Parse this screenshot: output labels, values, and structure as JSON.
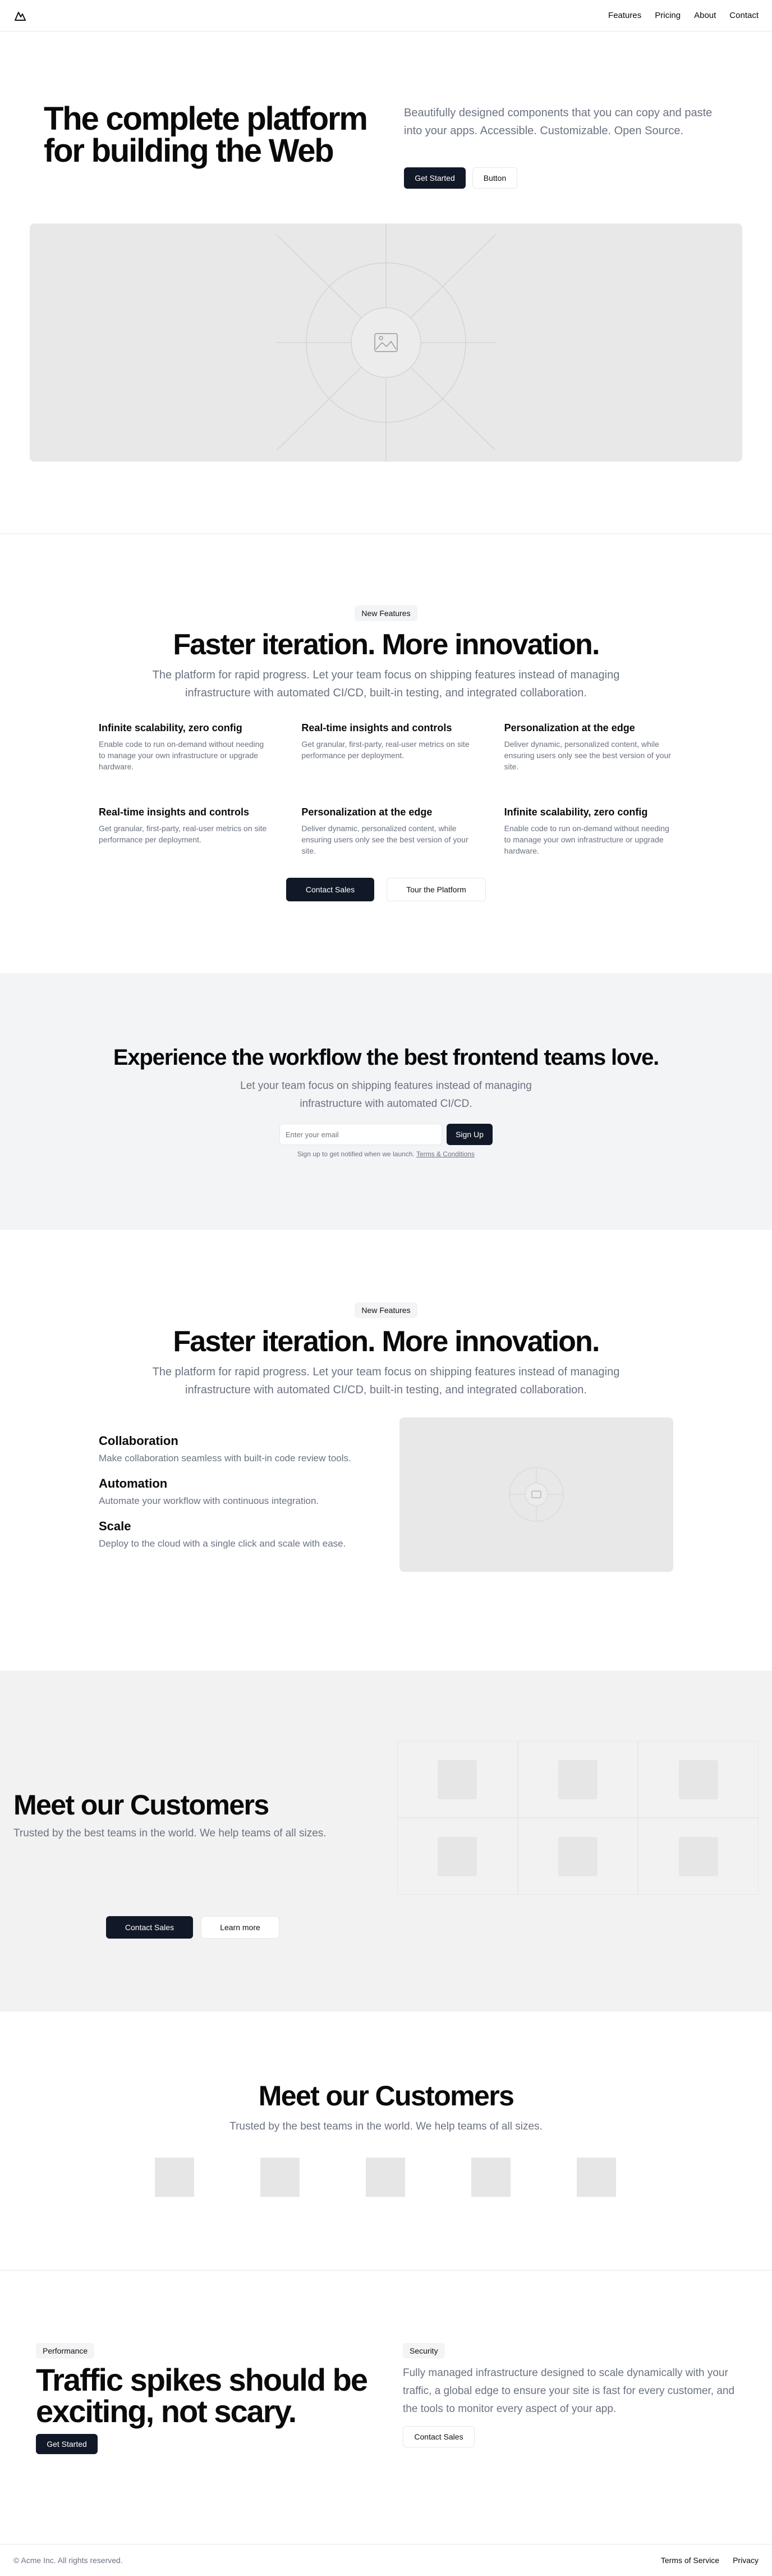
{
  "header": {
    "nav": [
      "Features",
      "Pricing",
      "About",
      "Contact"
    ]
  },
  "hero": {
    "title": "The complete platform for building the Web",
    "description": "Beautifully designed components that you can copy and paste into your apps. Accessible. Customizable. Open Source.",
    "primary_button": "Get Started",
    "secondary_button": "Button"
  },
  "features": {
    "badge": "New Features",
    "title": "Faster iteration. More innovation.",
    "subtitle": "The platform for rapid progress. Let your team focus on shipping features instead of managing infrastructure with automated CI/CD, built-in testing, and integrated collaboration.",
    "items": [
      {
        "title": "Infinite scalability, zero config",
        "text": "Enable code to run on-demand without needing to manage your own infrastructure or upgrade hardware."
      },
      {
        "title": "Real-time insights and controls",
        "text": "Get granular, first-party, real-user metrics on site performance per deployment."
      },
      {
        "title": "Personalization at the edge",
        "text": "Deliver dynamic, personalized content, while ensuring users only see the best version of your site."
      },
      {
        "title": "Real-time insights and controls",
        "text": "Get granular, first-party, real-user metrics on site performance per deployment."
      },
      {
        "title": "Personalization at the edge",
        "text": "Deliver dynamic, personalized content, while ensuring users only see the best version of your site."
      },
      {
        "title": "Infinite scalability, zero config",
        "text": "Enable code to run on-demand without needing to manage your own infrastructure or upgrade hardware."
      }
    ],
    "primary_button": "Contact Sales",
    "secondary_button": "Tour the Platform"
  },
  "signup": {
    "title": "Experience the workflow the best frontend teams love.",
    "subtitle": "Let your team focus on shipping features instead of managing infrastructure with automated CI/CD.",
    "placeholder": "Enter your email",
    "button": "Sign Up",
    "note": "Sign up to get notified when we launch.",
    "terms_link": "Terms & Conditions"
  },
  "features2": {
    "badge": "New Features",
    "title": "Faster iteration. More innovation.",
    "subtitle": "The platform for rapid progress. Let your team focus on shipping features instead of managing infrastructure with automated CI/CD, built-in testing, and integrated collaboration.",
    "items": [
      {
        "title": "Collaboration",
        "text": "Make collaboration seamless with built-in code review tools."
      },
      {
        "title": "Automation",
        "text": "Automate your workflow with continuous integration."
      },
      {
        "title": "Scale",
        "text": "Deploy to the cloud with a single click and scale with ease."
      }
    ]
  },
  "customers": {
    "title": "Meet our Customers",
    "subtitle": "Trusted by the best teams in the world. We help teams of all sizes.",
    "primary_button": "Contact Sales",
    "secondary_button": "Learn more"
  },
  "customers2": {
    "title": "Meet our Customers",
    "subtitle": "Trusted by the best teams in the world. We help teams of all sizes."
  },
  "traffic": {
    "badge": "Performance",
    "title": "Traffic spikes should be exciting, not scary.",
    "button": "Get Started",
    "badge2": "Security",
    "description": "Fully managed infrastructure designed to scale dynamically with your traffic, a global edge to ensure your site is fast for every customer, and the tools to monitor every aspect of your app.",
    "button2": "Contact Sales"
  },
  "footer": {
    "copyright": "© Acme Inc. All rights reserved.",
    "links": [
      "Terms of Service",
      "Privacy"
    ]
  },
  "colors": {
    "dark": "#111827",
    "muted": "#6b7280",
    "band": "#f3f4f6"
  },
  "icons": [
    "mountain-logo-icon",
    "image-placeholder-icon"
  ]
}
